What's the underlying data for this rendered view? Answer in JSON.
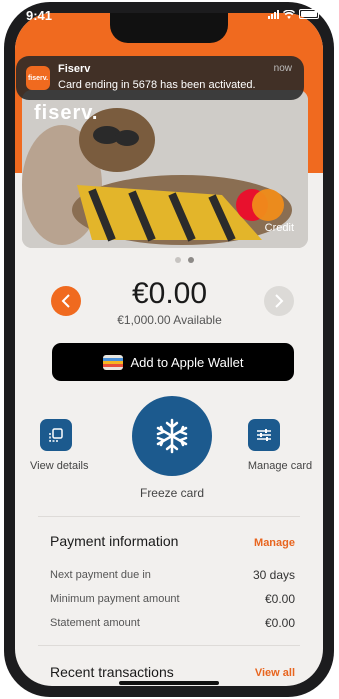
{
  "status": {
    "time": "9:41"
  },
  "notification": {
    "app_logo": "fiserv.",
    "app": "Fiserv",
    "time": "now",
    "message": "Card ending in 5678 has been activated."
  },
  "card": {
    "brand": "fiserv.",
    "type": "Credit",
    "network_icon": "mastercard-logo"
  },
  "balance": {
    "amount": "€0.00",
    "available": "€1,000.00 Available"
  },
  "wallet": {
    "label": "Add to Apple Wallet"
  },
  "actions": {
    "view_details": "View details",
    "freeze": "Freeze card",
    "manage": "Manage card"
  },
  "payment": {
    "title": "Payment information",
    "manage": "Manage",
    "rows": [
      {
        "label": "Next payment due in",
        "value": "30 days"
      },
      {
        "label": "Minimum payment amount",
        "value": "€0.00"
      },
      {
        "label": "Statement amount",
        "value": "€0.00"
      }
    ]
  },
  "recent": {
    "title": "Recent transactions",
    "view_all": "View all"
  },
  "colors": {
    "accent": "#f06a1f",
    "blue": "#1c5a8e"
  }
}
